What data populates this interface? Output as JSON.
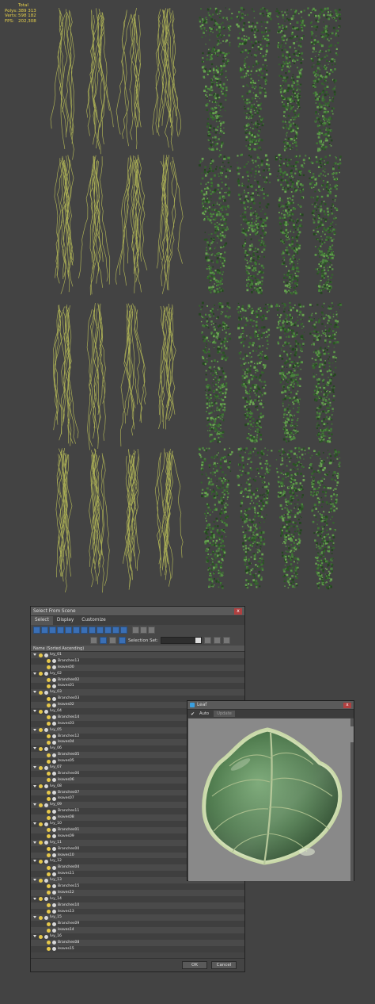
{
  "viewport": {
    "stats": [
      {
        "label": "",
        "value": "Total"
      },
      {
        "label": "Polys:",
        "value": "389 313"
      },
      {
        "label": "Verts:",
        "value": "598 182"
      },
      {
        "label": "",
        "value": ""
      },
      {
        "label": "FPS:",
        "value": "202,308"
      }
    ]
  },
  "select_dialog": {
    "title": "Select From Scene",
    "close": "x",
    "menu": [
      "Select",
      "Display",
      "Customize"
    ],
    "selection_set_label": "Selection Set:",
    "column_header": "Name (Sorted Ascending)",
    "ok": "OK",
    "cancel": "Cancel",
    "tree": [
      {
        "level": 0,
        "name": "Ivy_01"
      },
      {
        "level": 1,
        "name": "Branches13"
      },
      {
        "level": 1,
        "name": "leaves00"
      },
      {
        "level": 0,
        "name": "Ivy_02"
      },
      {
        "level": 1,
        "name": "Branches02"
      },
      {
        "level": 1,
        "name": "leaves01"
      },
      {
        "level": 0,
        "name": "Ivy_03"
      },
      {
        "level": 1,
        "name": "Branches03"
      },
      {
        "level": 1,
        "name": "leaves02"
      },
      {
        "level": 0,
        "name": "Ivy_04"
      },
      {
        "level": 1,
        "name": "Branches14"
      },
      {
        "level": 1,
        "name": "leaves03"
      },
      {
        "level": 0,
        "name": "Ivy_05"
      },
      {
        "level": 1,
        "name": "Branches12"
      },
      {
        "level": 1,
        "name": "leaves04"
      },
      {
        "level": 0,
        "name": "Ivy_06"
      },
      {
        "level": 1,
        "name": "Branches05"
      },
      {
        "level": 1,
        "name": "leaves05"
      },
      {
        "level": 0,
        "name": "Ivy_07"
      },
      {
        "level": 1,
        "name": "Branches06"
      },
      {
        "level": 1,
        "name": "leaves06"
      },
      {
        "level": 0,
        "name": "Ivy_08"
      },
      {
        "level": 1,
        "name": "Branches07"
      },
      {
        "level": 1,
        "name": "leaves07"
      },
      {
        "level": 0,
        "name": "Ivy_09"
      },
      {
        "level": 1,
        "name": "Branches11"
      },
      {
        "level": 1,
        "name": "leaves08"
      },
      {
        "level": 0,
        "name": "Ivy_10"
      },
      {
        "level": 1,
        "name": "Branches01"
      },
      {
        "level": 1,
        "name": "leaves09"
      },
      {
        "level": 0,
        "name": "Ivy_11"
      },
      {
        "level": 1,
        "name": "Branches00"
      },
      {
        "level": 1,
        "name": "leaves10"
      },
      {
        "level": 0,
        "name": "Ivy_12"
      },
      {
        "level": 1,
        "name": "Branches04"
      },
      {
        "level": 1,
        "name": "leaves11"
      },
      {
        "level": 0,
        "name": "Ivy_13"
      },
      {
        "level": 1,
        "name": "Branches15"
      },
      {
        "level": 1,
        "name": "leaves12"
      },
      {
        "level": 0,
        "name": "Ivy_14"
      },
      {
        "level": 1,
        "name": "Branches10"
      },
      {
        "level": 1,
        "name": "leaves13"
      },
      {
        "level": 0,
        "name": "Ivy_15"
      },
      {
        "level": 1,
        "name": "Branches09"
      },
      {
        "level": 1,
        "name": "leaves14"
      },
      {
        "level": 0,
        "name": "Ivy_16"
      },
      {
        "level": 1,
        "name": "Branches08"
      },
      {
        "level": 1,
        "name": "leaves15"
      }
    ]
  },
  "leaf_window": {
    "title": "Leaf",
    "close": "x",
    "auto_label": "Auto",
    "update_label": "Update"
  },
  "colors": {
    "viewport_bg": "#434343",
    "stats_text": "#e8d24a",
    "branch": "#a9ad55",
    "leaf_dark": "#2d5a26",
    "leaf_light": "#5e9a48"
  }
}
